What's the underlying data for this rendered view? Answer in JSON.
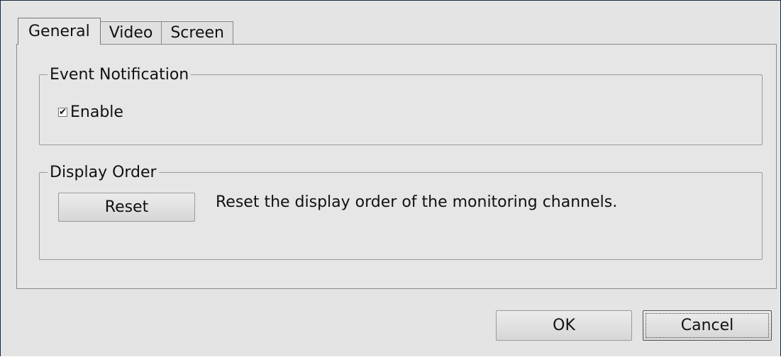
{
  "tabs": [
    {
      "label": "General",
      "active": true
    },
    {
      "label": "Video",
      "active": false
    },
    {
      "label": "Screen",
      "active": false
    }
  ],
  "event_notification": {
    "title": "Event Notification",
    "enable_label": "Enable",
    "enable_checked": true,
    "check_glyph": "✔"
  },
  "display_order": {
    "title": "Display Order",
    "reset_label": "Reset",
    "description": "Reset the display order of the monitoring channels."
  },
  "footer": {
    "ok_label": "OK",
    "cancel_label": "Cancel"
  }
}
